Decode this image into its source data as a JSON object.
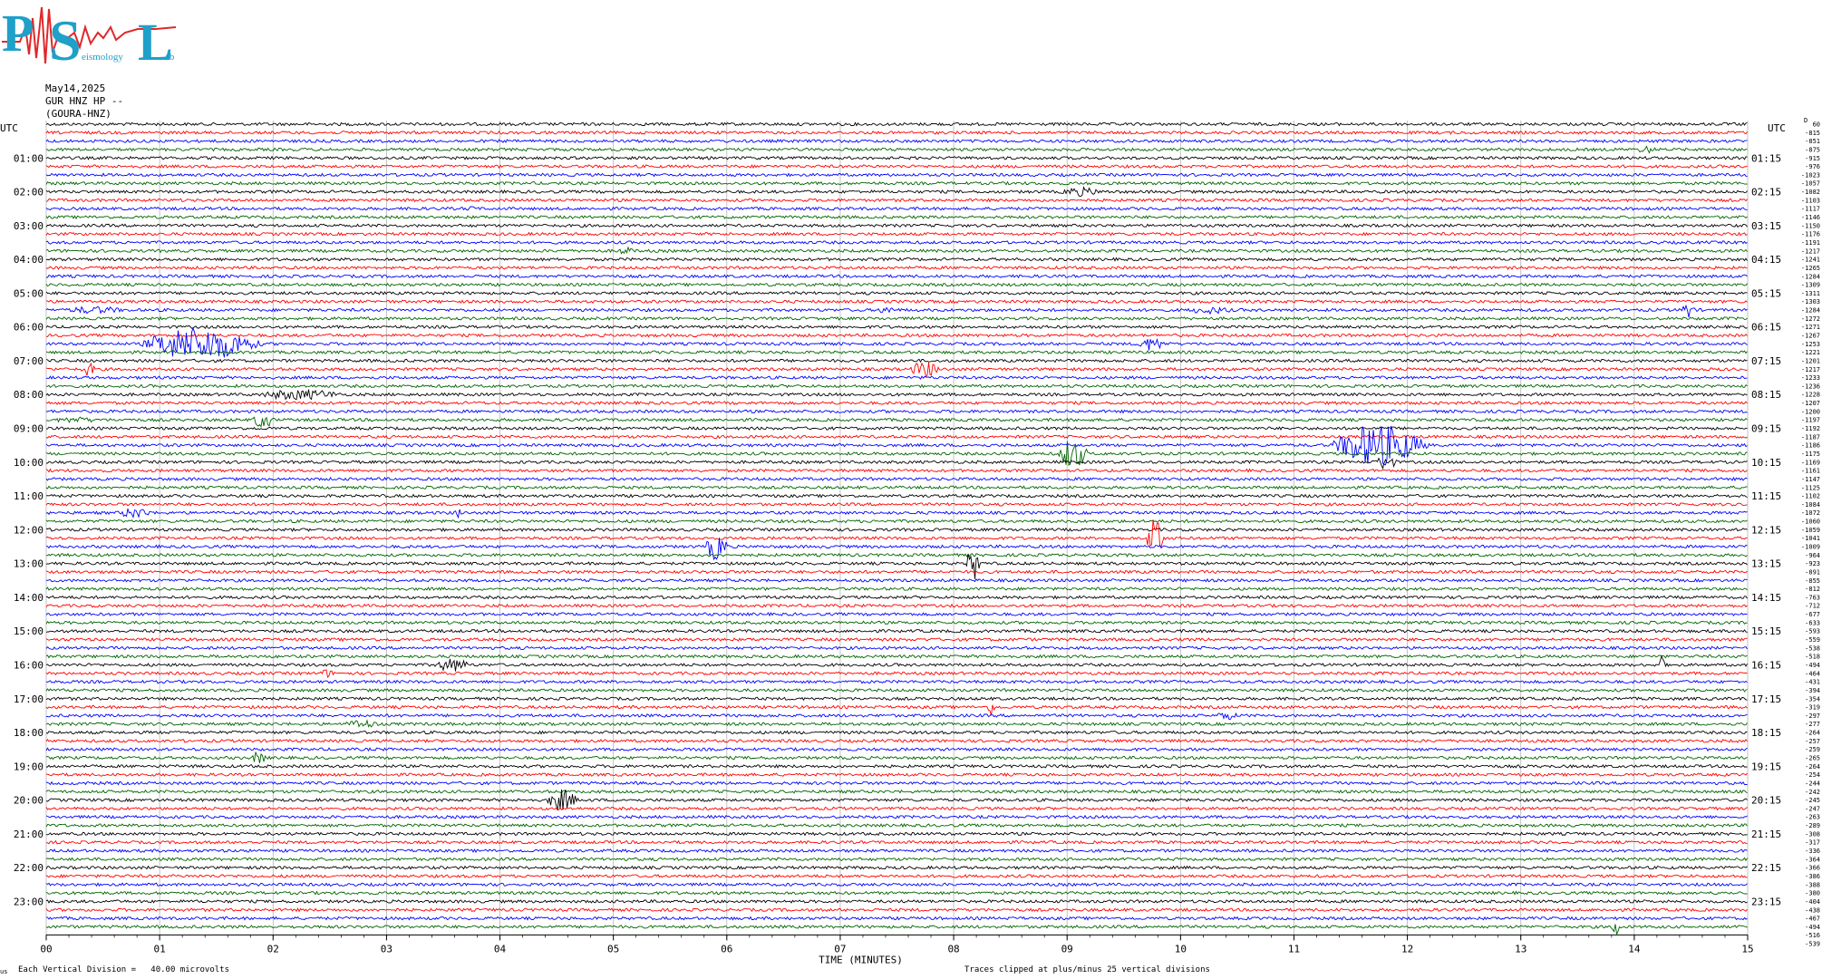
{
  "logo": {
    "letters": [
      "P",
      "S",
      "L"
    ],
    "small_words": [
      "eismology",
      "ab"
    ],
    "colors": {
      "letters": "#1fa0c8",
      "trace": "#e0282a"
    }
  },
  "header": {
    "date": "May14,2025",
    "station": "GUR HNZ HP --",
    "channel": "(GOURA-HNZ)"
  },
  "axis": {
    "left_unit": "UTC",
    "right_unit": "UTC",
    "left_labels": [
      "01:00",
      "02:00",
      "03:00",
      "04:00",
      "05:00",
      "06:00",
      "07:00",
      "08:00",
      "09:00",
      "10:00",
      "11:00",
      "12:00",
      "13:00",
      "14:00",
      "15:00",
      "16:00",
      "17:00",
      "18:00",
      "19:00",
      "20:00",
      "21:00",
      "22:00",
      "23:00"
    ],
    "right_labels": [
      "01:15",
      "02:15",
      "03:15",
      "04:15",
      "05:15",
      "06:15",
      "07:15",
      "08:15",
      "09:15",
      "10:15",
      "11:15",
      "12:15",
      "13:15",
      "14:15",
      "15:15",
      "16:15",
      "17:15",
      "18:15",
      "19:15",
      "20:15",
      "21:15",
      "22:15",
      "23:15"
    ],
    "x_ticks": [
      "00",
      "01",
      "02",
      "03",
      "04",
      "05",
      "06",
      "07",
      "08",
      "09",
      "10",
      "11",
      "12",
      "13",
      "14",
      "15"
    ],
    "xlabel": "TIME (MINUTES)"
  },
  "footer": {
    "left_mark": "us",
    "division": "Each Vertical Division =   40.00 microvolts",
    "clip_note": "Traces clipped at plus/minus 25 vertical divisions"
  },
  "chart_data": {
    "type": "line",
    "title": "",
    "xlabel": "TIME (MINUTES)",
    "ylabel": "UTC",
    "xlim": [
      0,
      15
    ],
    "rows_per_hour": 4,
    "row_count": 96,
    "row_colors": [
      "#000000",
      "#ff0000",
      "#0000ff",
      "#006400"
    ],
    "dc_offsets_header": "D",
    "dc_offsets": [
      60,
      -815,
      -851,
      -875,
      -915,
      -976,
      -1023,
      -1057,
      -1082,
      -1103,
      -1117,
      -1146,
      -1150,
      -1176,
      -1191,
      -1217,
      -1241,
      -1265,
      -1284,
      -1309,
      -1311,
      -1303,
      -1284,
      -1272,
      -1271,
      -1267,
      -1253,
      -1221,
      -1201,
      -1217,
      -1233,
      -1236,
      -1228,
      -1207,
      -1200,
      -1197,
      -1192,
      -1187,
      -1186,
      -1175,
      -1169,
      -1161,
      -1147,
      -1125,
      -1102,
      -1084,
      -1072,
      -1060,
      -1059,
      -1041,
      -1009,
      -964,
      -923,
      -891,
      -855,
      -812,
      -763,
      -712,
      -677,
      -633,
      -593,
      -559,
      -538,
      -518,
      -494,
      -464,
      -431,
      -394,
      -354,
      -319,
      -297,
      -277,
      -264,
      -257,
      -259,
      -265,
      -264,
      -254,
      -244,
      -242,
      -245,
      -247,
      -263,
      -289,
      -308,
      -317,
      -336,
      -364,
      -366,
      -386,
      -388,
      -380,
      -404,
      -438,
      -467,
      -494,
      -516,
      -539
    ],
    "events": [
      {
        "row": 3,
        "start_min": 14.0,
        "end_min": 14.3,
        "amp": 5
      },
      {
        "row": 8,
        "start_min": 8.9,
        "end_min": 9.5,
        "amp": 6
      },
      {
        "row": 10,
        "start_min": 3.7,
        "end_min": 3.8,
        "amp": 6
      },
      {
        "row": 15,
        "start_min": 5.0,
        "end_min": 5.3,
        "amp": 5
      },
      {
        "row": 22,
        "start_min": 0.1,
        "end_min": 1.0,
        "amp": 5
      },
      {
        "row": 22,
        "start_min": 7.3,
        "end_min": 7.6,
        "amp": 5
      },
      {
        "row": 22,
        "start_min": 10.0,
        "end_min": 10.7,
        "amp": 5
      },
      {
        "row": 22,
        "start_min": 14.4,
        "end_min": 14.6,
        "amp": 10
      },
      {
        "row": 26,
        "start_min": 0.8,
        "end_min": 2.3,
        "amp": 22
      },
      {
        "row": 26,
        "start_min": 9.6,
        "end_min": 10.0,
        "amp": 9
      },
      {
        "row": 29,
        "start_min": 0.3,
        "end_min": 0.5,
        "amp": 9
      },
      {
        "row": 29,
        "start_min": 7.6,
        "end_min": 8.0,
        "amp": 11
      },
      {
        "row": 32,
        "start_min": 1.8,
        "end_min": 3.0,
        "amp": 7
      },
      {
        "row": 35,
        "start_min": 0.0,
        "end_min": 0.7,
        "amp": 4
      },
      {
        "row": 35,
        "start_min": 1.8,
        "end_min": 2.1,
        "amp": 11
      },
      {
        "row": 38,
        "start_min": 11.3,
        "end_min": 12.5,
        "amp": 28
      },
      {
        "row": 39,
        "start_min": 8.9,
        "end_min": 9.3,
        "amp": 20
      },
      {
        "row": 40,
        "start_min": 11.7,
        "end_min": 12.0,
        "amp": 10
      },
      {
        "row": 46,
        "start_min": 0.6,
        "end_min": 1.1,
        "amp": 7
      },
      {
        "row": 46,
        "start_min": 3.6,
        "end_min": 3.7,
        "amp": 8
      },
      {
        "row": 49,
        "start_min": 9.7,
        "end_min": 9.9,
        "amp": 40
      },
      {
        "row": 50,
        "start_min": 5.8,
        "end_min": 6.1,
        "amp": 18
      },
      {
        "row": 52,
        "start_min": 8.1,
        "end_min": 8.3,
        "amp": 22
      },
      {
        "row": 64,
        "start_min": 3.4,
        "end_min": 3.9,
        "amp": 9
      },
      {
        "row": 64,
        "start_min": 14.2,
        "end_min": 14.3,
        "amp": 22
      },
      {
        "row": 65,
        "start_min": 2.4,
        "end_min": 2.6,
        "amp": 6
      },
      {
        "row": 69,
        "start_min": 8.3,
        "end_min": 8.4,
        "amp": 14
      },
      {
        "row": 70,
        "start_min": 10.3,
        "end_min": 10.6,
        "amp": 6
      },
      {
        "row": 71,
        "start_min": 2.6,
        "end_min": 3.1,
        "amp": 6
      },
      {
        "row": 75,
        "start_min": 1.8,
        "end_min": 2.0,
        "amp": 9
      },
      {
        "row": 80,
        "start_min": 4.4,
        "end_min": 4.8,
        "amp": 15
      },
      {
        "row": 95,
        "start_min": 13.8,
        "end_min": 13.9,
        "amp": 18
      }
    ]
  }
}
